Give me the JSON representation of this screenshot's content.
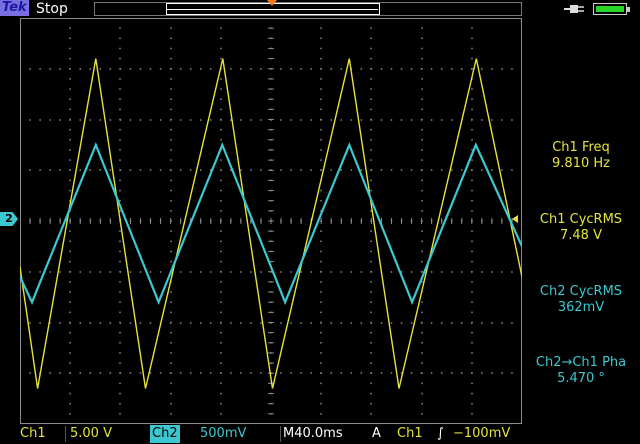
{
  "header": {
    "logo": "Tek",
    "status": "Stop"
  },
  "measurements": [
    {
      "label": "Ch1 Freq",
      "value": "9.810 Hz",
      "channel": "ch1"
    },
    {
      "label": "Ch1 CycRMS",
      "value": "7.48 V",
      "channel": "ch1"
    },
    {
      "label": "Ch2 CycRMS",
      "value": "362mV",
      "channel": "ch2"
    },
    {
      "label": "Ch2→Ch1 Pha",
      "value": "5.470 °",
      "channel": "ch2"
    }
  ],
  "markers": {
    "ch2_ground": "2"
  },
  "footer": {
    "ch1_label": "Ch1",
    "ch1_scale": "5.00 V",
    "ch2_label": "Ch2",
    "ch2_scale": "500mV",
    "timebase": "M40.0ms",
    "trigger_mode": "A",
    "trigger_source": "Ch1",
    "trigger_slope": "∫",
    "trigger_level": "−100mV"
  },
  "colors": {
    "ch1": "#e4e43c",
    "ch2": "#3cc8d0",
    "trigger": "#ff7a1a",
    "grid": "#8a8a8a"
  },
  "icons": {
    "power": "ac-plug-icon",
    "battery": "battery-icon"
  },
  "chart_data": {
    "type": "line",
    "divisions": {
      "x": 10,
      "y": 8
    },
    "series": [
      {
        "name": "Ch1",
        "points_div": [
          [
            0,
            -0.9
          ],
          [
            0.35,
            -3.3
          ],
          [
            1.51,
            3.2
          ],
          [
            2.5,
            -3.3
          ],
          [
            4.04,
            3.2
          ],
          [
            5.03,
            -3.3
          ],
          [
            6.56,
            3.2
          ],
          [
            7.55,
            -3.3
          ],
          [
            9.09,
            3.2
          ],
          [
            10,
            -1.1
          ]
        ]
      },
      {
        "name": "Ch2",
        "points_div": [
          [
            0,
            -1.1
          ],
          [
            0.24,
            -1.6
          ],
          [
            1.51,
            1.5
          ],
          [
            2.76,
            -1.6
          ],
          [
            4.03,
            1.5
          ],
          [
            5.28,
            -1.6
          ],
          [
            6.56,
            1.5
          ],
          [
            7.81,
            -1.6
          ],
          [
            9.08,
            1.5
          ],
          [
            10,
            -0.5
          ]
        ]
      }
    ]
  }
}
